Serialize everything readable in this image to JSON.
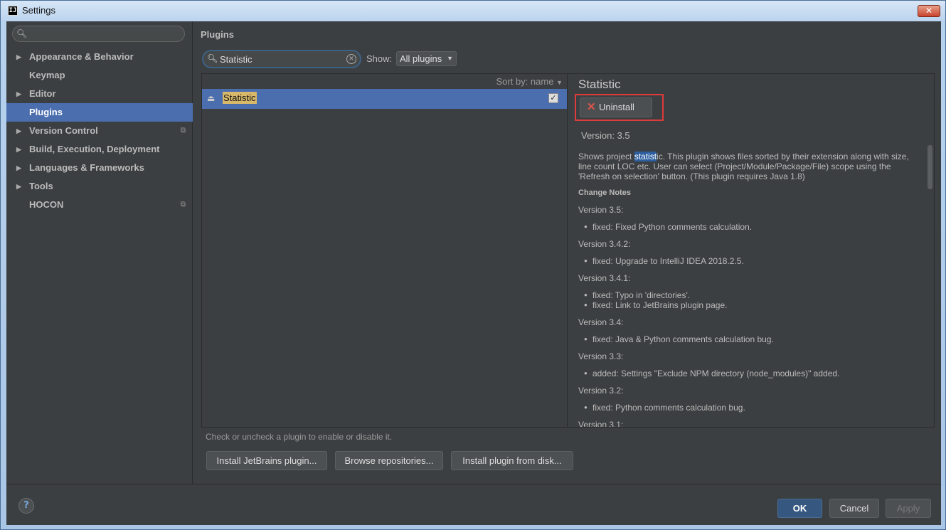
{
  "window": {
    "title": "Settings",
    "app_icon": "intellij-icon",
    "close_label": "✕"
  },
  "sidebar": {
    "search_placeholder": "",
    "items": [
      {
        "label": "Appearance & Behavior",
        "expandable": true,
        "selected": false
      },
      {
        "label": "Keymap",
        "expandable": false,
        "selected": false
      },
      {
        "label": "Editor",
        "expandable": true,
        "selected": false
      },
      {
        "label": "Plugins",
        "expandable": false,
        "selected": true
      },
      {
        "label": "Version Control",
        "expandable": true,
        "selected": false
      },
      {
        "label": "Build, Execution, Deployment",
        "expandable": true,
        "selected": false
      },
      {
        "label": "Languages & Frameworks",
        "expandable": true,
        "selected": false
      },
      {
        "label": "Tools",
        "expandable": true,
        "selected": false
      },
      {
        "label": "HOCON",
        "expandable": false,
        "selected": false
      }
    ]
  },
  "plugins": {
    "title": "Plugins",
    "search_value": "Statistic",
    "show_label": "Show:",
    "show_value": "All plugins",
    "sort_label": "Sort by: name",
    "list": [
      {
        "name": "Statistic",
        "enabled": true
      }
    ],
    "hint": "Check or uncheck a plugin to enable or disable it.",
    "buttons": {
      "install_jetbrains": "Install JetBrains plugin...",
      "browse": "Browse repositories...",
      "install_disk": "Install plugin from disk..."
    }
  },
  "details": {
    "title": "Statistic",
    "uninstall_label": "Uninstall",
    "version": "Version: 3.5",
    "desc_before": "Shows project ",
    "desc_highlight": "statist",
    "desc_after": "ic. This plugin shows files sorted by their extension along with size, line count LOC etc. User can select (Project/Module/Package/File) scope using the 'Refresh on selection' button. (This plugin requires Java 1.8)",
    "change_notes_label": "Change Notes",
    "notes": [
      {
        "version": "Version 3.5:",
        "items": [
          "fixed: Fixed Python comments calculation."
        ]
      },
      {
        "version": "Version 3.4.2:",
        "items": [
          "fixed: Upgrade to IntelliJ IDEA 2018.2.5."
        ]
      },
      {
        "version": "Version 3.4.1:",
        "items": [
          "fixed: Typo in 'directories'.",
          "fixed: Link to JetBrains plugin page."
        ]
      },
      {
        "version": "Version 3.4:",
        "items": [
          "fixed: Java & Python comments calculation bug."
        ]
      },
      {
        "version": "Version 3.3:",
        "items": [
          "added: Settings \"Exclude NPM directory (node_modules)\" added."
        ]
      },
      {
        "version": "Version 3.2:",
        "items": [
          "fixed: Python comments calculation bug."
        ]
      },
      {
        "version": "Version 3.1:",
        "items": []
      }
    ]
  },
  "footer": {
    "help": "?",
    "ok": "OK",
    "cancel": "Cancel",
    "apply": "Apply"
  },
  "colors": {
    "selection": "#4b6eaf",
    "background": "#3c3f41",
    "highlight_box": "#e03b3b",
    "search_match": "#d8b86a"
  }
}
